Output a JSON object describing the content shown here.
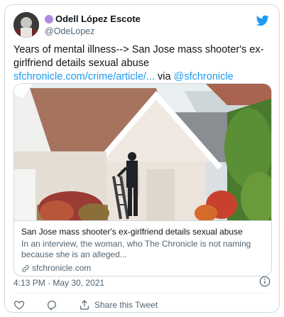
{
  "tweet": {
    "author_name": "Odell López Escote",
    "author_handle": "@OdeLopez",
    "text_prefix": "Years of mental illness--> San Jose mass shooter's ex-girlfriend details sexual abuse",
    "link_text": "sfchronicle.com/crime/article/...",
    "via_text": " via ",
    "mention": "@sfchronicle",
    "timestamp": "4:13 PM · May 30, 2021"
  },
  "link_card": {
    "title": "San Jose mass shooter's ex-girlfriend details sexual abuse",
    "description": "In an interview, the woman, who The Chronicle is not naming because she is an alleged...",
    "domain": "sfchronicle.com"
  },
  "actions": {
    "share_label": "Share this Tweet"
  },
  "icons": {
    "brand": "twitter-bird-icon",
    "info": "info-icon",
    "like": "heart-icon",
    "reply": "reply-icon",
    "share": "share-icon",
    "link": "link-icon"
  },
  "colors": {
    "accent": "#1d9bf0",
    "text": "#0f1419",
    "secondary": "#536471",
    "border": "#cfd9de",
    "name_badge": "#b08be0"
  }
}
